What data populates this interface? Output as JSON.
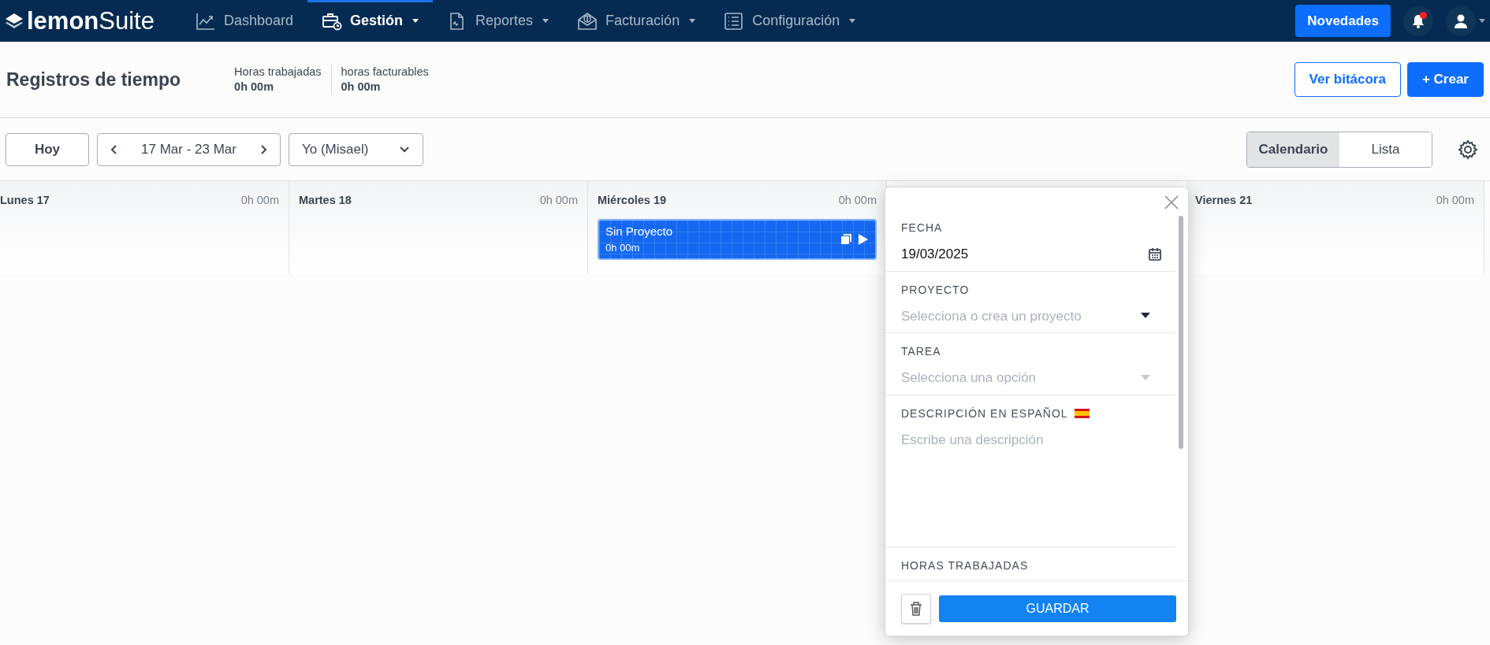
{
  "brand": {
    "bold": "lemon",
    "light": "Suite"
  },
  "nav": [
    {
      "label": "Dashboard",
      "selected": false,
      "dropdown": false
    },
    {
      "label": "Gestión",
      "selected": true,
      "dropdown": true
    },
    {
      "label": "Reportes",
      "selected": false,
      "dropdown": true
    },
    {
      "label": "Facturación",
      "selected": false,
      "dropdown": true
    },
    {
      "label": "Configuración",
      "selected": false,
      "dropdown": true
    }
  ],
  "news_button": "Novedades",
  "notifications": {
    "unread": true
  },
  "header": {
    "title": "Registros de tiempo",
    "stats": [
      {
        "label": "Horas trabajadas",
        "value": "0h 00m"
      },
      {
        "label": "horas facturables",
        "value": "0h 00m"
      }
    ],
    "buttons": [
      {
        "label": "Ver bitácora",
        "kind": "outline"
      },
      {
        "label": "+ Crear",
        "kind": "primary"
      }
    ]
  },
  "toolbar": {
    "today": "Hoy",
    "range": "17 Mar - 23 Mar",
    "user": "Yo (Misael)",
    "views": [
      {
        "label": "Calendario",
        "selected": true
      },
      {
        "label": "Lista",
        "selected": false
      }
    ]
  },
  "days": [
    {
      "label": "Lunes 17",
      "total": "0h 00m"
    },
    {
      "label": "Martes 18",
      "total": "0h 00m"
    },
    {
      "label": "Miércoles 19",
      "total": "0h 00m",
      "entries": [
        {
          "project": "Sin Proyecto",
          "duration": "0h 00m"
        }
      ]
    },
    {
      "label": "Viernes 21",
      "total": "0h 00m"
    }
  ],
  "popover": {
    "fields": [
      {
        "kind": "date",
        "label": "FECHA",
        "value": "19/03/2025"
      },
      {
        "kind": "select",
        "label": "PROYECTO",
        "placeholder": "Selecciona o crea un proyecto",
        "disabled": false
      },
      {
        "kind": "select",
        "label": "TAREA",
        "placeholder": "Selecciona una opción",
        "disabled": true
      },
      {
        "kind": "textarea",
        "label": "DESCRIPCIÓN EN ESPAÑOL",
        "placeholder": "Escribe una descripción"
      },
      {
        "kind": "hours",
        "label": "HORAS TRABAJADAS"
      }
    ],
    "save": "GUARDAR"
  }
}
